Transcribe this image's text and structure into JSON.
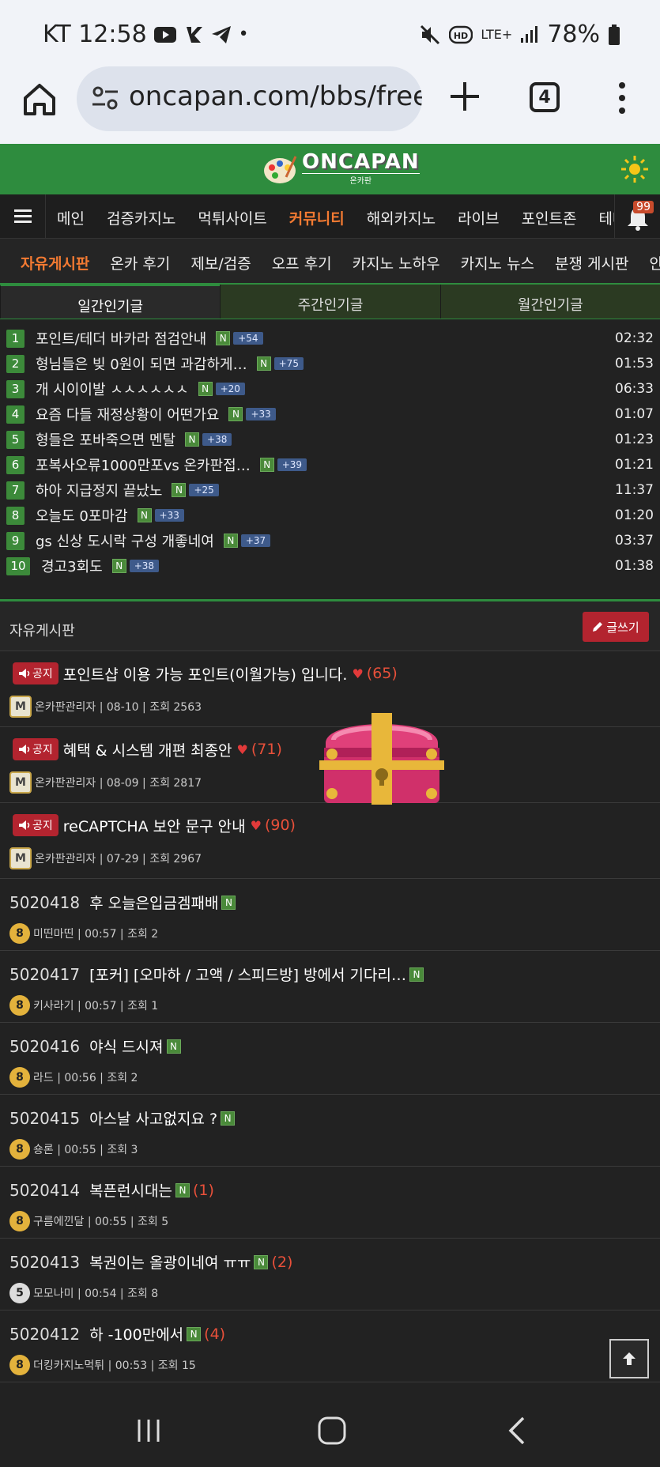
{
  "status_bar": {
    "carrier_time": "KT 12:58",
    "battery": "78%",
    "network": "LTE+"
  },
  "browser": {
    "url": "oncapan.com/bbs/free",
    "tab_count": "4"
  },
  "site": {
    "logo_text": "ONCAPAN",
    "logo_sub": "온카판",
    "bell_count": "99"
  },
  "main_nav": [
    "메인",
    "검증카지노",
    "먹튀사이트",
    "커뮤니티",
    "해외카지노",
    "라이브",
    "포인트존",
    "테마"
  ],
  "main_nav_active": 3,
  "sub_nav": [
    "자유게시판",
    "온카 후기",
    "제보/검증",
    "오프 후기",
    "카지노 노하우",
    "카지노 뉴스",
    "분쟁 게시판",
    "안전"
  ],
  "popular_tabs": [
    "일간인기글",
    "주간인기글",
    "월간인기글"
  ],
  "popular_posts": [
    {
      "rank": "1",
      "title": "포인트/테더 바카라 점검안내",
      "new": "N",
      "count": "+54",
      "time": "02:32"
    },
    {
      "rank": "2",
      "title": "형님들은 빚 0원이 되면 과감하게…",
      "new": "N",
      "count": "+75",
      "time": "01:53"
    },
    {
      "rank": "3",
      "title": "개 시이이발 ㅅㅅㅅㅅㅅㅅ",
      "new": "N",
      "count": "+20",
      "time": "06:33"
    },
    {
      "rank": "4",
      "title": "요즘 다들 재정상황이 어떤가요",
      "new": "N",
      "count": "+33",
      "time": "01:07"
    },
    {
      "rank": "5",
      "title": "형들은 포바죽으면 멘탈",
      "new": "N",
      "count": "+38",
      "time": "01:23"
    },
    {
      "rank": "6",
      "title": "포복사오류1000만포vs 온카판접…",
      "new": "N",
      "count": "+39",
      "time": "01:21"
    },
    {
      "rank": "7",
      "title": "하아 지급정지 끝났노",
      "new": "N",
      "count": "+25",
      "time": "11:37"
    },
    {
      "rank": "8",
      "title": "오늘도 0포마감",
      "new": "N",
      "count": "+33",
      "time": "01:20"
    },
    {
      "rank": "9",
      "title": "gs 신상 도시락 구성 개좋네여",
      "new": "N",
      "count": "+37",
      "time": "03:37"
    },
    {
      "rank": "10",
      "title": "경고3회도",
      "new": "N",
      "count": "+38",
      "time": "01:38"
    }
  ],
  "board": {
    "title": "자유게시판",
    "write_label": "글쓰기"
  },
  "notices": [
    {
      "badge": "공지",
      "title": "포인트샵 이용 가능 포인트(이월가능) 입니다.",
      "likes": "(65)",
      "meta": "온카판관리자 | 08-10 | 조회 2563",
      "level": "M"
    },
    {
      "badge": "공지",
      "title": "혜택 & 시스템 개편 최종안",
      "likes": "(71)",
      "meta": "온카판관리자 | 08-09 | 조회 2817",
      "level": "M"
    },
    {
      "badge": "공지",
      "title": "reCAPTCHA 보안 문구 안내",
      "likes": "(90)",
      "meta": "온카판관리자 | 07-29 | 조회 2967",
      "level": "M"
    }
  ],
  "posts": [
    {
      "num": "5020418",
      "title": "후 오늘은입금겜패배",
      "new": "N",
      "comments": "",
      "meta": "미띤마띤 | 00:57 | 조회 2",
      "level": "8"
    },
    {
      "num": "5020417",
      "title": "[포커] [오마하 / 고액 / 스피드방] 방에서 기다리…",
      "new": "N",
      "comments": "",
      "meta": "키사라기 | 00:57 | 조회 1",
      "level": "8"
    },
    {
      "num": "5020416",
      "title": "야식 드시져",
      "new": "N",
      "comments": "",
      "meta": "라드 | 00:56 | 조회 2",
      "level": "8"
    },
    {
      "num": "5020415",
      "title": "아스날 사고없지요 ?",
      "new": "N",
      "comments": "",
      "meta": "숑론 | 00:55 | 조회 3",
      "level": "8"
    },
    {
      "num": "5020414",
      "title": "복픈런시대는",
      "new": "N",
      "comments": "(1)",
      "meta": "구름에낀달 | 00:55 | 조회 5",
      "level": "8"
    },
    {
      "num": "5020413",
      "title": "복권이는 올광이네여 ㅠㅠ",
      "new": "N",
      "comments": "(2)",
      "meta": "모모나미 | 00:54 | 조회 8",
      "level": "5"
    },
    {
      "num": "5020412",
      "title": "하 -100만에서",
      "new": "N",
      "comments": "(4)",
      "meta": "더킹카지노먹튀 | 00:53 | 조회 15",
      "level": "8"
    }
  ],
  "colors": {
    "brand_green": "#2e8c3e",
    "accent_orange": "#f37a32",
    "notice_red": "#b3242f",
    "comment_red": "#e8503a"
  }
}
